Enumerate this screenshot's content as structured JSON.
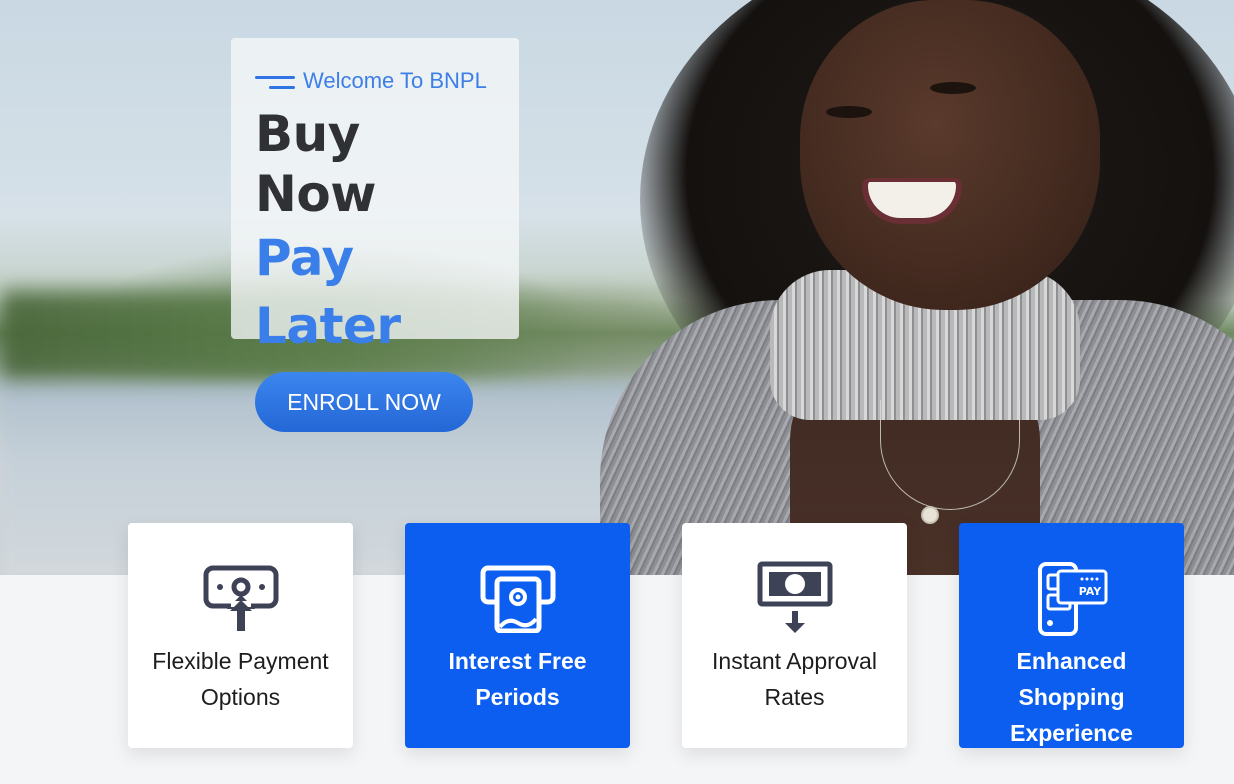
{
  "hero": {
    "welcome": "Welcome To BNPL",
    "title_line1": "Buy Now",
    "title_line2": "Pay Later",
    "cta_label": "ENROLL NOW"
  },
  "features": [
    {
      "label": "Flexible Payment Options",
      "icon": "payment-upload-icon",
      "style": "white"
    },
    {
      "label": "Interest Free Periods",
      "icon": "cash-withdraw-icon",
      "style": "blue"
    },
    {
      "label": "Instant Approval Rates",
      "icon": "money-down-icon",
      "style": "white"
    },
    {
      "label": "Enhanced Shopping Experience",
      "icon": "mobile-pay-icon",
      "style": "blue"
    }
  ],
  "colors": {
    "accent_blue": "#0b5ef0",
    "title_blue": "#3a7ee9",
    "title_dark": "#2f3134",
    "icon_dark": "#3e4256"
  }
}
